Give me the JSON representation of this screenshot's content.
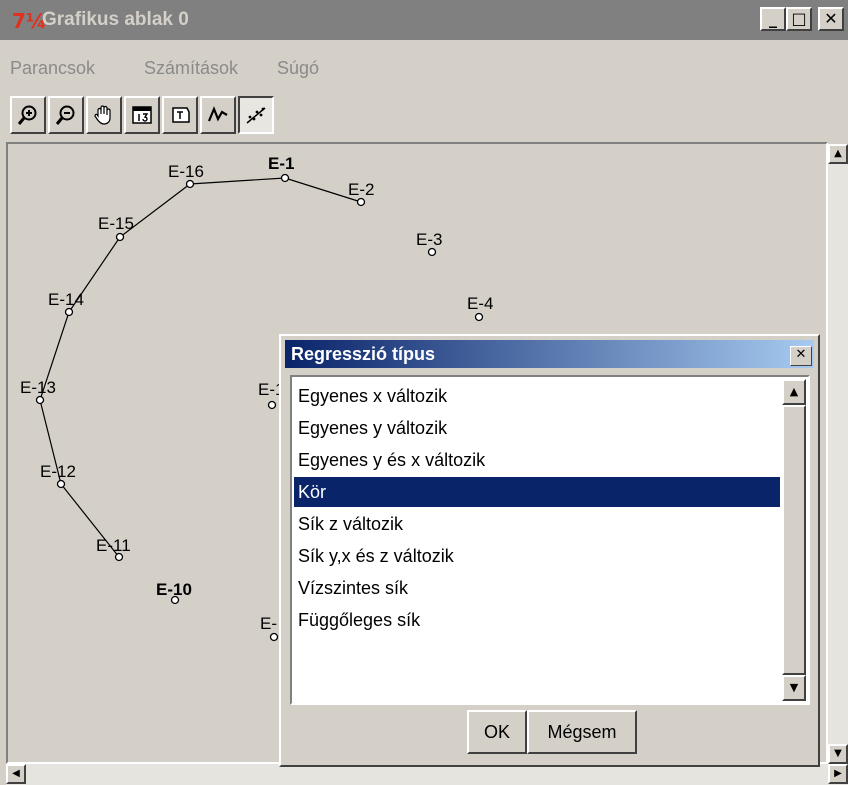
{
  "window": {
    "icon_text": "7¼",
    "title": "Grafikus ablak 0",
    "minimize": "_",
    "maximize": "□",
    "close": "✕"
  },
  "menu": {
    "items": [
      "Parancsok",
      "Számítások",
      "Súgó"
    ]
  },
  "toolbar": {
    "buttons": [
      {
        "icon": "zoom-in-icon",
        "pressed": false
      },
      {
        "icon": "zoom-out-icon",
        "pressed": false
      },
      {
        "icon": "pan-hand-icon",
        "pressed": false
      },
      {
        "icon": "fit-view-icon",
        "pressed": false
      },
      {
        "icon": "text-label-icon",
        "pressed": false
      },
      {
        "icon": "polyline-icon",
        "pressed": false
      },
      {
        "icon": "regression-line-icon",
        "pressed": true
      }
    ]
  },
  "points": [
    {
      "label": "E-1"
    },
    {
      "label": "E-2"
    },
    {
      "label": "E-3"
    },
    {
      "label": "E-4"
    },
    {
      "label": "E-1"
    },
    {
      "label": "E-10"
    },
    {
      "label": "E-11"
    },
    {
      "label": "E-12"
    },
    {
      "label": "E-13"
    },
    {
      "label": "E-14"
    },
    {
      "label": "E-15"
    },
    {
      "label": "E-16"
    },
    {
      "label": "E-"
    }
  ],
  "dialog": {
    "title": "Regresszió típus",
    "close": "✕",
    "options": [
      "Egyenes x változik",
      "Egyenes y változik",
      "Egyenes y és x változik",
      "Kör",
      "Sík z változik",
      "Sík y,x és z változik",
      "Vízszintes sík",
      "Függőleges sík"
    ],
    "selected_index": 3,
    "ok_label": "OK",
    "cancel_label": "Mégsem"
  },
  "colors": {
    "selection": "#0a246a",
    "face": "#d4d0c8",
    "titlebar_inactive": "#808080",
    "app_icon": "#e03020"
  }
}
